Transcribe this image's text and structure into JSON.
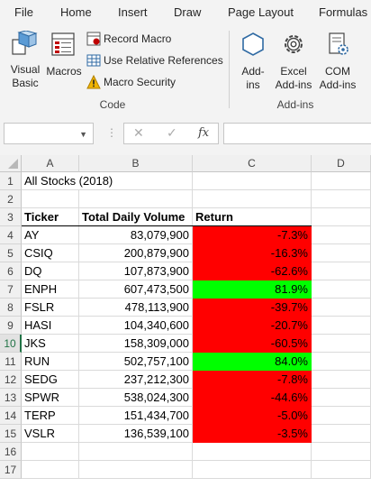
{
  "ribbon_tabs": [
    "File",
    "Home",
    "Insert",
    "Draw",
    "Page Layout",
    "Formulas"
  ],
  "code_group": {
    "visual_basic_line1": "Visual",
    "visual_basic_line2": "Basic",
    "macros": "Macros",
    "record_macro": "Record Macro",
    "use_relative_references": "Use Relative References",
    "macro_security": "Macro Security",
    "label": "Code"
  },
  "addins_group": {
    "addins_line1": "Add-",
    "addins_line2": "ins",
    "excel_addins_line1": "Excel",
    "excel_addins_line2": "Add-ins",
    "com_addins_line1": "COM",
    "com_addins_line2": "Add-ins",
    "label": "Add-ins"
  },
  "formula_bar": {
    "name_box_value": "",
    "cancel_symbol": "✕",
    "enter_symbol": "✓",
    "fx_symbol": "fx",
    "formula_value": ""
  },
  "columns": [
    "A",
    "B",
    "C",
    "D"
  ],
  "rows": [
    "1",
    "2",
    "3",
    "4",
    "5",
    "6",
    "7",
    "8",
    "9",
    "10",
    "11",
    "12",
    "13",
    "14",
    "15",
    "16",
    "17"
  ],
  "selected_row": "10",
  "sheet": {
    "title": "All Stocks (2018)",
    "headers": [
      "Ticker",
      "Total Daily Volume",
      "Return"
    ],
    "data": [
      {
        "ticker": "AY",
        "volume": "83,079,900",
        "return": "-7.3%",
        "status": "neg"
      },
      {
        "ticker": "CSIQ",
        "volume": "200,879,900",
        "return": "-16.3%",
        "status": "neg"
      },
      {
        "ticker": "DQ",
        "volume": "107,873,900",
        "return": "-62.6%",
        "status": "neg"
      },
      {
        "ticker": "ENPH",
        "volume": "607,473,500",
        "return": "81.9%",
        "status": "pos"
      },
      {
        "ticker": "FSLR",
        "volume": "478,113,900",
        "return": "-39.7%",
        "status": "neg"
      },
      {
        "ticker": "HASI",
        "volume": "104,340,600",
        "return": "-20.7%",
        "status": "neg"
      },
      {
        "ticker": "JKS",
        "volume": "158,309,000",
        "return": "-60.5%",
        "status": "neg"
      },
      {
        "ticker": "RUN",
        "volume": "502,757,100",
        "return": "84.0%",
        "status": "pos"
      },
      {
        "ticker": "SEDG",
        "volume": "237,212,300",
        "return": "-7.8%",
        "status": "neg"
      },
      {
        "ticker": "SPWR",
        "volume": "538,024,300",
        "return": "-44.6%",
        "status": "neg"
      },
      {
        "ticker": "TERP",
        "volume": "151,434,700",
        "return": "-5.0%",
        "status": "neg"
      },
      {
        "ticker": "VSLR",
        "volume": "136,539,100",
        "return": "-3.5%",
        "status": "neg"
      }
    ]
  },
  "colors": {
    "negative_fill": "#ff0000",
    "positive_fill": "#00ff00",
    "excel_green": "#217346"
  }
}
